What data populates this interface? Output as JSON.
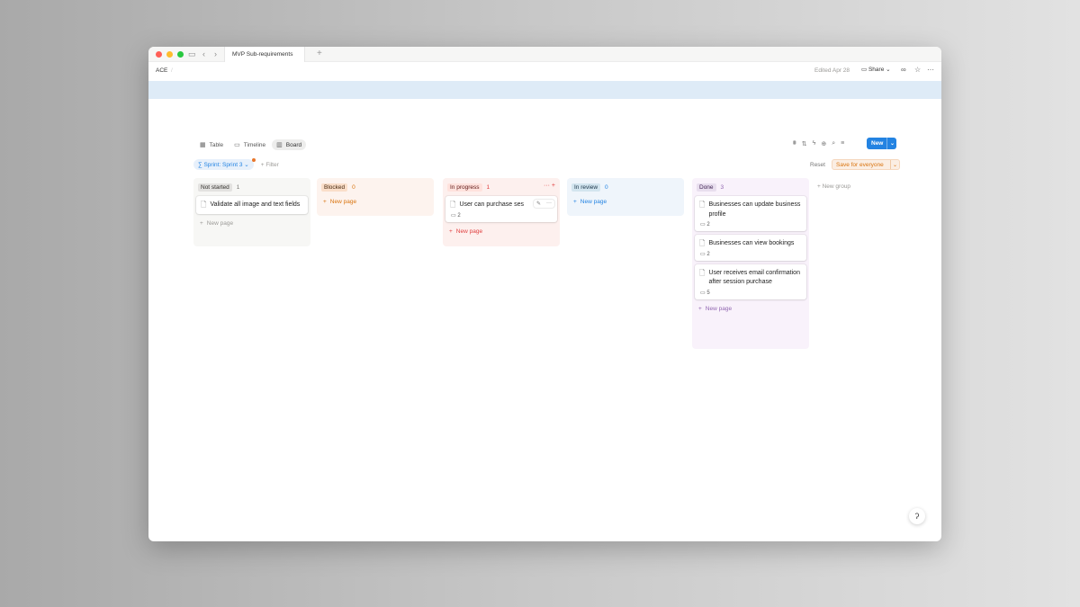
{
  "browser": {
    "tab_title": "MVP Sub-requirements",
    "new_tab_icon": "+"
  },
  "topbar": {
    "breadcrumb": "ACE",
    "breadcrumb_sep": "/",
    "edited": "Edited Apr 28",
    "share_label": "Share"
  },
  "views": [
    {
      "label": "Table",
      "icon": "table-icon"
    },
    {
      "label": "Timeline",
      "icon": "timeline-icon"
    },
    {
      "label": "Board",
      "icon": "board-icon"
    }
  ],
  "toolbar": {
    "new_label": "New",
    "chevron": "⌄"
  },
  "filters": {
    "sprint_label": "Sprint: Sprint 3",
    "add_filter": "+ Filter",
    "reset": "Reset",
    "save_label": "Save for everyone"
  },
  "columns": {
    "not_started": {
      "label": "Not started",
      "count": "1",
      "cards": [
        {
          "title": "Validate all image and text fields"
        }
      ],
      "new_page": "New page"
    },
    "blocked": {
      "label": "Blocked",
      "count": "0",
      "new_page": "New page"
    },
    "in_progress": {
      "label": "In progress",
      "count": "1",
      "cards": [
        {
          "title": "User can purchase ses",
          "comments": "2"
        }
      ],
      "new_page": "New page",
      "actions": "··· +"
    },
    "in_review": {
      "label": "In review",
      "count": "0",
      "new_page": "New page"
    },
    "done": {
      "label": "Done",
      "count": "3",
      "cards": [
        {
          "title": "Businesses can update business profile",
          "comments": "2"
        },
        {
          "title": "Businesses can view bookings",
          "comments": "2"
        },
        {
          "title": "User receives email confirmation after session purchase",
          "comments": "5"
        }
      ],
      "new_page": "New page"
    }
  },
  "new_group": "New group",
  "help_icon": "ʔ",
  "colors": {
    "accent": "#2383e2",
    "not_started_pill": "#e3e2e0",
    "blocked_pill": "#fadec9",
    "in_progress_pill": "#ffe2dd",
    "in_review_pill": "#d3e5ef",
    "done_pill": "#e8deee",
    "banner": "#deebf7"
  }
}
